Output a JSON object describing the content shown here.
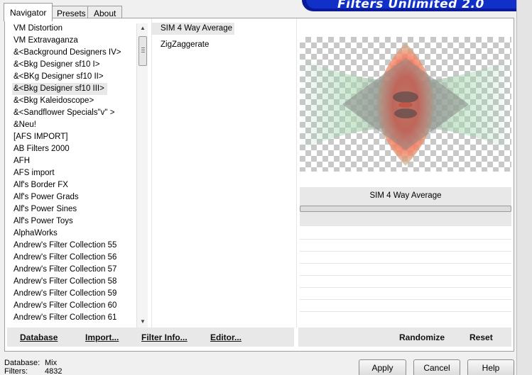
{
  "banner": {
    "title": "Filters Unlimited 2.0"
  },
  "tabs": [
    {
      "label": "Navigator",
      "active": true
    },
    {
      "label": "Presets",
      "active": false
    },
    {
      "label": "About",
      "active": false
    }
  ],
  "categories": [
    "VM Distortion",
    "VM Extravaganza",
    "&<Background Designers IV>",
    "&<Bkg Designer sf10 I>",
    "&<BKg Designer sf10 II>",
    "&<Bkg Designer sf10 III>",
    "&<Bkg Kaleidoscope>",
    "&<Sandflower Specials\"v\" >",
    "&Neu!",
    "[AFS IMPORT]",
    "AB Filters 2000",
    "AFH",
    "AFS import",
    "Alf's Border FX",
    "Alf's Power Grads",
    "Alf's Power Sines",
    "Alf's Power Toys",
    "AlphaWorks",
    "Andrew's Filter Collection 55",
    "Andrew's Filter Collection 56",
    "Andrew's Filter Collection 57",
    "Andrew's Filter Collection 58",
    "Andrew's Filter Collection 59",
    "Andrew's Filter Collection 60",
    "Andrew's Filter Collection 61"
  ],
  "selected_category": "&<Bkg Designer sf10 III>",
  "filters": [
    "SIM 4 Way Average",
    "ZigZaggerate"
  ],
  "selected_filter": "SIM 4 Way Average",
  "preview": {
    "filter_name": "SIM 4 Way Average"
  },
  "toolbar": {
    "database": "Database",
    "import": "Import...",
    "filter_info": "Filter Info...",
    "editor": "Editor...",
    "randomize": "Randomize",
    "reset": "Reset"
  },
  "status": {
    "database_label": "Database:",
    "database_value": "Mix",
    "filters_label": "Filters:",
    "filters_value": "4832"
  },
  "buttons": {
    "apply": "Apply",
    "cancel": "Cancel",
    "help": "Help"
  }
}
